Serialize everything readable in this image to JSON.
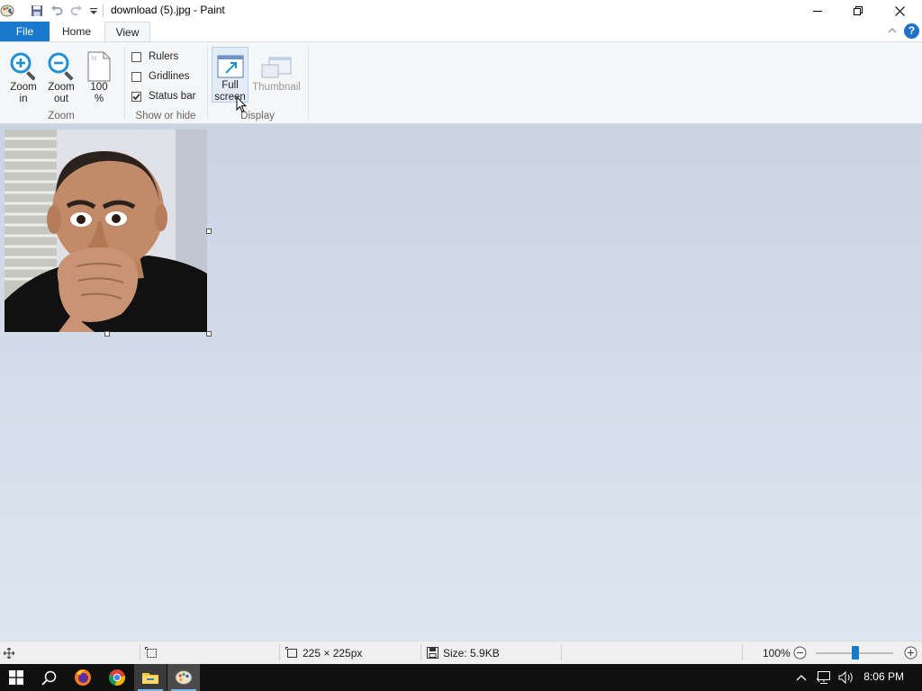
{
  "window": {
    "title": "download (5).jpg - Paint"
  },
  "tabs": [
    {
      "label": "File"
    },
    {
      "label": "Home"
    },
    {
      "label": "View"
    }
  ],
  "ribbon": {
    "zoom_in": {
      "line1": "Zoom",
      "line2": "in"
    },
    "zoom_out": {
      "line1": "Zoom",
      "line2": "out"
    },
    "zoom_100": {
      "line1": "100",
      "line2": "%"
    },
    "zoom_group": "Zoom",
    "rulers": {
      "label": "Rulers",
      "checked": false
    },
    "gridlines": {
      "label": "Gridlines",
      "checked": false
    },
    "status_bar": {
      "label": "Status bar",
      "checked": true
    },
    "show_hide_group": "Show or hide",
    "full_screen": {
      "line1": "Full",
      "line2": "screen"
    },
    "thumbnail": {
      "label": "Thumbnail"
    },
    "display_group": "Display"
  },
  "statusbar": {
    "dimensions": "225 × 225px",
    "size": "Size: 5.9KB",
    "zoom": "100%"
  },
  "taskbar": {
    "time": "8:06 PM"
  },
  "colors": {
    "file_tab": "#1979ca",
    "accent_blue": "#1e90d4",
    "canvas_bg": "#cfd8e6"
  }
}
